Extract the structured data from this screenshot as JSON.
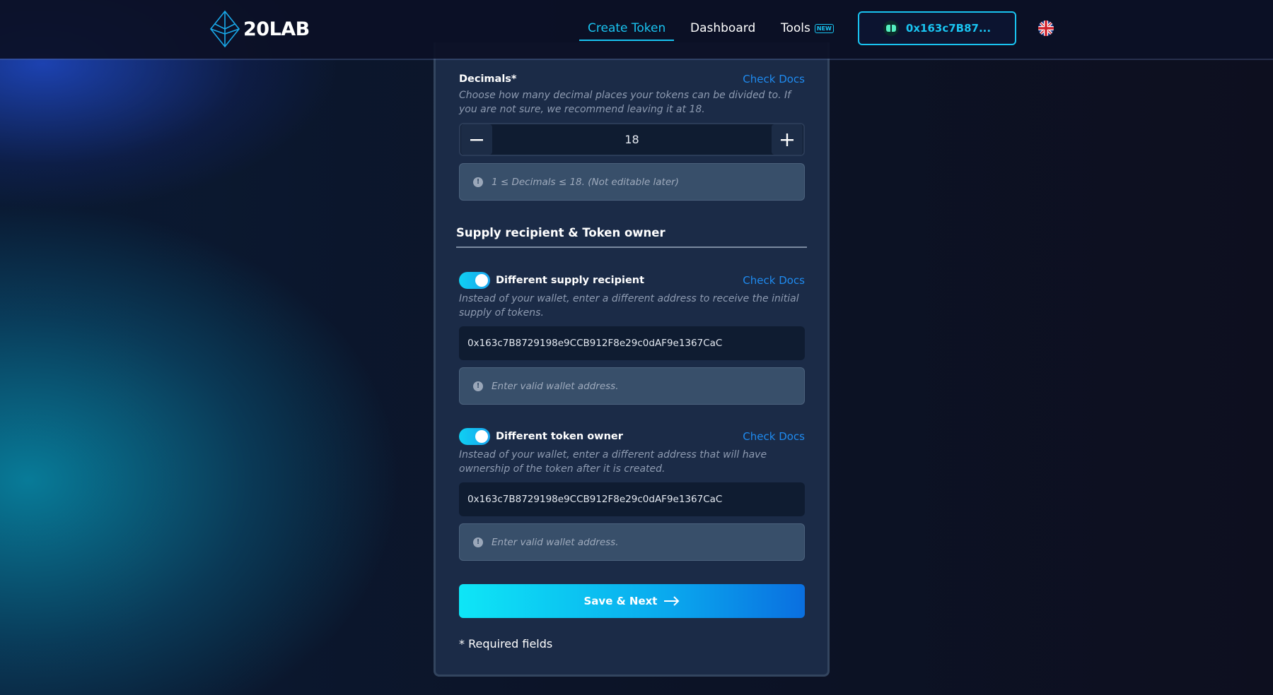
{
  "header": {
    "brand": "20LAB",
    "nav": [
      {
        "label": "Create Token",
        "active": true
      },
      {
        "label": "Dashboard"
      },
      {
        "label": "Tools",
        "badge": "NEW"
      }
    ],
    "wallet_label": "0x163c7B87...",
    "language_icon": "uk-flag-icon"
  },
  "decimals": {
    "label": "Decimals*",
    "docs_link": "Check Docs",
    "help": "Choose how many decimal places your tokens can be divided to. If you are not sure, we recommend leaving it at 18.",
    "value": "18",
    "decrement_icon": "minus-icon",
    "increment_icon": "plus-icon",
    "info": "1 ≤ Decimals ≤ 18. (Not editable later)"
  },
  "section": {
    "title": "Supply recipient & Token owner"
  },
  "supply_recipient": {
    "label": "Different supply recipient",
    "enabled": true,
    "docs_link": "Check Docs",
    "help": "Instead of your wallet, enter a different address to receive the initial supply of tokens.",
    "address": "0x163c7B8729198e9CCB912F8e29c0dAF9e1367CaC",
    "info": "Enter valid wallet address."
  },
  "token_owner": {
    "label": "Different token owner",
    "enabled": true,
    "docs_link": "Check Docs",
    "help": "Instead of your wallet, enter a different address that will have ownership of the token after it is created.",
    "address": "0x163c7B8729198e9CCB912F8e29c0dAF9e1367CaC",
    "info": "Enter valid wallet address."
  },
  "actions": {
    "save_label": "Save & Next",
    "arrow_icon": "arrow-right-icon",
    "required_note": "* Required fields"
  },
  "colors": {
    "accent": "#19c3f0",
    "link": "#1f8bf0",
    "card": "#1b2b47",
    "page": "#0d0f1f"
  }
}
